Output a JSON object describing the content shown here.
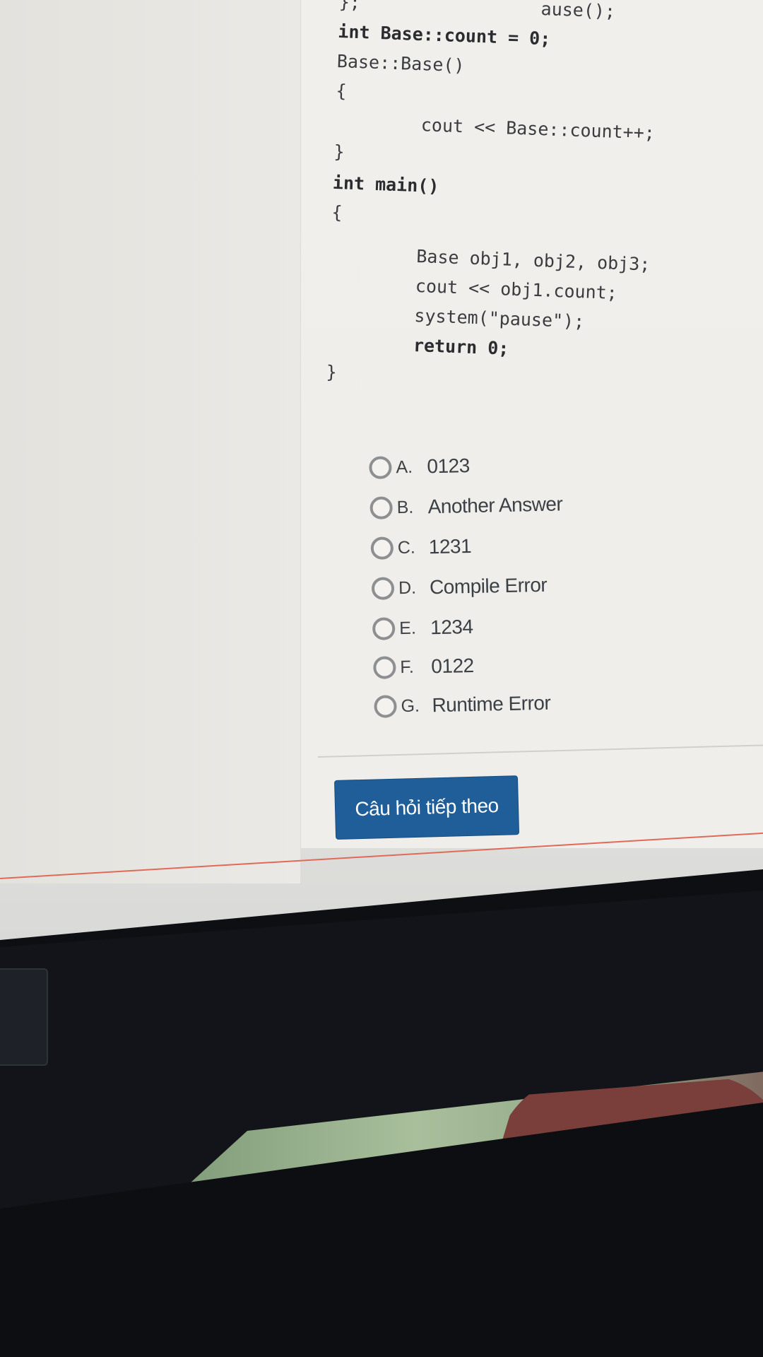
{
  "code": {
    "lines": [
      "};                 ause();",
      "int Base::count = 0;",
      "Base::Base()",
      "{",
      "cout << Base::count++;",
      "}",
      "int main()",
      "{",
      "Base obj1, obj2, obj3;",
      "cout << obj1.count;",
      "system(\"pause\");",
      "return 0;",
      "}"
    ]
  },
  "options": [
    {
      "letter": "A.",
      "text": "0123"
    },
    {
      "letter": "B.",
      "text": "Another Answer"
    },
    {
      "letter": "C.",
      "text": "1231"
    },
    {
      "letter": "D.",
      "text": "Compile Error"
    },
    {
      "letter": "E.",
      "text": "1234"
    },
    {
      "letter": "F.",
      "text": "0122"
    },
    {
      "letter": "G.",
      "text": "Runtime Error"
    }
  ],
  "next_button": {
    "label": "Câu hỏi tiếp theo"
  },
  "colors": {
    "button": "#1f5e98",
    "radio_border": "#8d8f91",
    "page_bg": "#efeeea"
  }
}
